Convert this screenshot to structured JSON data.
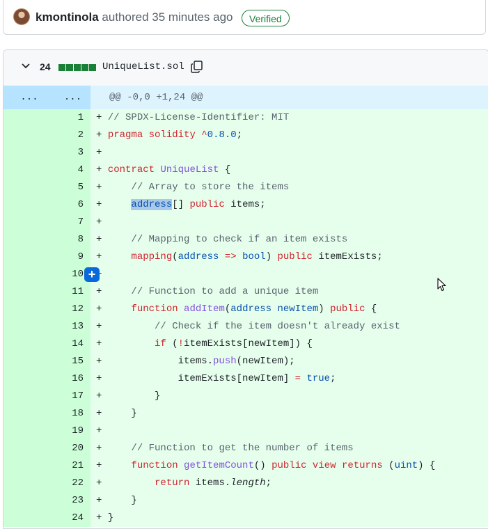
{
  "commit": {
    "author": "kmontinola",
    "authored_text": "authored 35 minutes ago",
    "verified_label": "Verified"
  },
  "file": {
    "changes_count": "24",
    "filename": "UniqueList.sol"
  },
  "hunk": {
    "old_ellipsis": "...",
    "new_ellipsis": "...",
    "header": "@@ -0,0 +1,24 @@"
  },
  "colors": {
    "added_bg": "#e6ffec",
    "added_gutter": "#ccffd8",
    "hunk_bg": "#ddf4ff",
    "keyword": "#cf222e",
    "type": "#0550ae",
    "function": "#8250df",
    "comment": "#59636e",
    "accent": "#0969da",
    "verified_green": "#1a7f37"
  },
  "icons": [
    "chevron-down-icon",
    "copy-icon",
    "plus-icon",
    "mouse-pointer-icon"
  ]
}
